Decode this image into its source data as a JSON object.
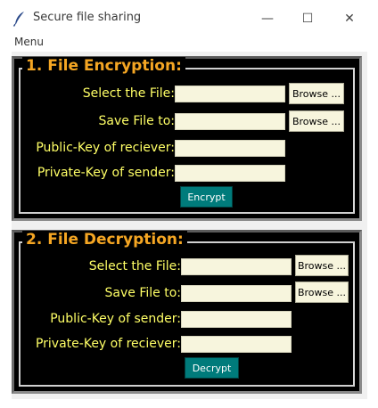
{
  "window": {
    "title": "Secure file sharing",
    "controls": {
      "minimize": "—",
      "maximize": "☐",
      "close": "✕"
    }
  },
  "menubar": {
    "menu": "Menu"
  },
  "encryption": {
    "title": "1. File Encryption:",
    "select_file_label": "Select the File:",
    "save_to_label": "Save File to:",
    "public_key_label": "Public-Key of reciever:",
    "private_key_label": "Private-Key of sender:",
    "browse_label_1": "Browse ...",
    "browse_label_2": "Browse ...",
    "action_label": "Encrypt",
    "select_file_value": "",
    "save_to_value": "",
    "public_key_value": "",
    "private_key_value": ""
  },
  "decryption": {
    "title": "2. File Decryption:",
    "select_file_label": "Select the File:",
    "save_to_label": "Save File to:",
    "public_key_label": "Public-Key of sender:",
    "private_key_label": "Private-Key of reciever:",
    "browse_label_1": "Browse ...",
    "browse_label_2": "Browse ...",
    "action_label": "Decrypt",
    "select_file_value": "",
    "save_to_value": "",
    "public_key_value": "",
    "private_key_value": ""
  },
  "colors": {
    "frame_bg": "#000000",
    "title_color": "#f5a623",
    "label_color": "#ffff66",
    "field_bg": "#f7f5dd",
    "action_bg": "#007b7b"
  },
  "icons": {
    "app_icon": "feather-icon"
  }
}
